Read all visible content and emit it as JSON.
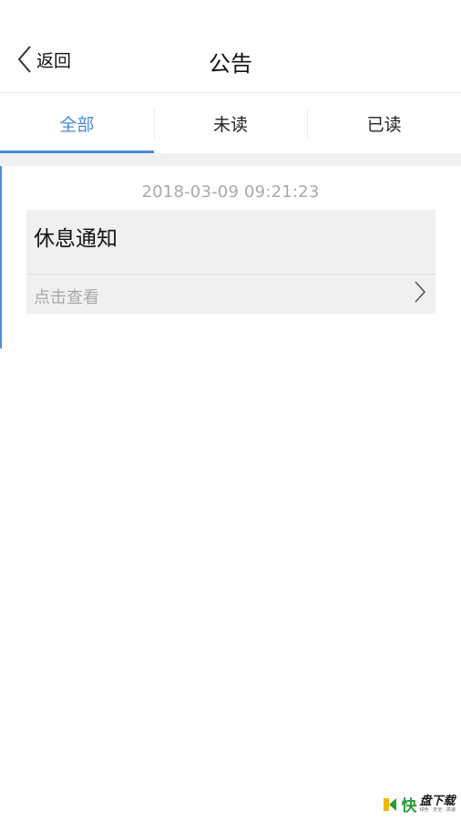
{
  "navbar": {
    "back_label": "返回",
    "title": "公告"
  },
  "tabs": [
    {
      "label": "全部",
      "active": true
    },
    {
      "label": "未读",
      "active": false
    },
    {
      "label": "已读",
      "active": false
    }
  ],
  "notices": [
    {
      "timestamp": "2018-03-09 09:21:23",
      "title": "休息通知",
      "link_label": "点击查看"
    }
  ],
  "colors": {
    "accent": "#4a8bd6",
    "muted_text": "#a9a9a9",
    "card_bg": "#f0f0f0"
  },
  "watermark": {
    "kuai": "快",
    "main": "盘下载",
    "sub": "绿色 · 安全 · 高速"
  }
}
